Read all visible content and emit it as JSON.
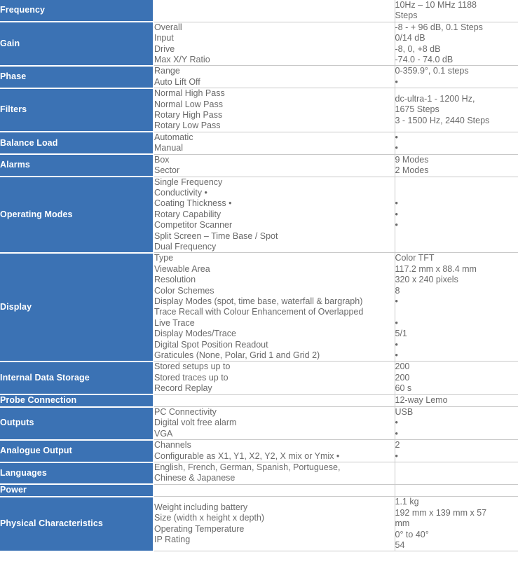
{
  "table": {
    "colors": {
      "label_background": "#3b72b4",
      "label_text": "#ffffff",
      "body_text": "#6a6a6a",
      "border": "#c9c9c9",
      "page_background": "#ffffff"
    },
    "rows": [
      {
        "label": "Frequency",
        "features": [],
        "values": [
          "10Hz – 10 MHz 1188",
          "Steps"
        ]
      },
      {
        "label": "Gain",
        "features": [
          "Overall",
          "Input",
          "Drive",
          "Max X/Y Ratio"
        ],
        "values": [
          "-8 - + 96 dB, 0.1 Steps",
          "0/14 dB",
          "-8, 0, +8 dB",
          "-74.0 - 74.0 dB"
        ]
      },
      {
        "label": "Phase",
        "features": [
          "Range",
          "Auto Lift Off"
        ],
        "values": [
          "0-359.9°, 0.1 steps",
          "•"
        ]
      },
      {
        "label": "Filters",
        "features": [
          "Normal High Pass",
          "Normal Low Pass",
          "Rotary High Pass",
          "Rotary Low Pass"
        ],
        "values": [
          "dc-ultra-1 - 1200 Hz,",
          "1675 Steps",
          "3 - 1500 Hz, 2440 Steps"
        ]
      },
      {
        "label": "Balance Load",
        "features": [
          "Automatic",
          "Manual"
        ],
        "values": [
          "•",
          "•"
        ]
      },
      {
        "label": "Alarms",
        "features": [
          "Box",
          "Sector"
        ],
        "values": [
          "9 Modes",
          "2 Modes"
        ]
      },
      {
        "label": "Operating Modes",
        "features": [
          "Single Frequency",
          "Conductivity •",
          "Coating Thickness •",
          "Rotary Capability",
          "Competitor Scanner",
          "Split Screen – Time Base / Spot",
          "Dual Frequency"
        ],
        "values": [
          "",
          "",
          "•",
          "•",
          "•",
          "",
          ""
        ]
      },
      {
        "label": "Display",
        "features": [
          "Type",
          "Viewable Area",
          "Resolution",
          "Color Schemes",
          "Display Modes (spot, time base, waterfall & bargraph)",
          "Trace Recall with Colour Enhancement of Overlapped",
          "Live Trace",
          "Display Modes/Trace",
          "Digital Spot Position Readout",
          "Graticules (None, Polar, Grid 1 and Grid 2)"
        ],
        "values": [
          "Color TFT",
          "117.2 mm x 88.4 mm",
          "320 x 240 pixels",
          "8",
          "•",
          "",
          "•",
          "5/1",
          "•",
          "•"
        ]
      },
      {
        "label": "Internal Data Storage",
        "features": [
          "Stored setups up to",
          "Stored traces up to",
          "Record Replay"
        ],
        "values": [
          "200",
          "200",
          "60 s"
        ]
      },
      {
        "label": "Probe Connection",
        "features": [],
        "values": [
          "12-way Lemo"
        ]
      },
      {
        "label": "Outputs",
        "features": [
          "PC Connectivity",
          "Digital volt free alarm",
          "VGA"
        ],
        "values": [
          "USB",
          "•",
          "•"
        ]
      },
      {
        "label": "Analogue Output",
        "features": [
          "Channels",
          "Configurable as X1, Y1, X2, Y2, X mix or Ymix •"
        ],
        "values": [
          "2",
          "•"
        ]
      },
      {
        "label": "Languages",
        "features": [
          "English, French, German, Spanish, Portuguese,",
          "Chinese & Japanese"
        ],
        "values": []
      },
      {
        "label": "Power",
        "features": [],
        "values": []
      },
      {
        "label": "Physical Characteristics",
        "features": [
          "Weight including battery",
          "Size (width x height x depth)",
          "Operating Temperature",
          "IP Rating"
        ],
        "values": [
          "1.1 kg",
          "192 mm x 139 mm x 57",
          "mm",
          "0° to 40°",
          "54"
        ]
      }
    ]
  }
}
